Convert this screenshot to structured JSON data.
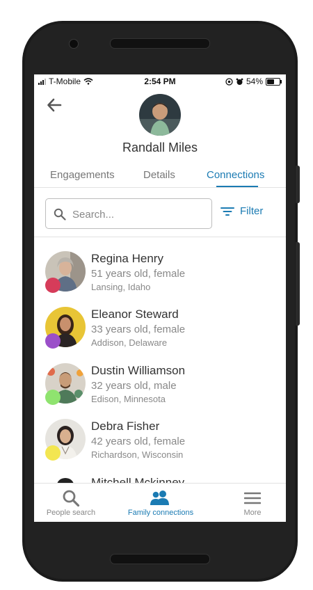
{
  "status_bar": {
    "carrier": "T-Mobile",
    "time": "2:54 PM",
    "battery": "54%"
  },
  "header": {
    "name": "Randall Miles"
  },
  "tabs": [
    {
      "label": "Engagements"
    },
    {
      "label": "Details"
    },
    {
      "label": "Connections"
    }
  ],
  "search": {
    "placeholder": "Search..."
  },
  "filter": {
    "label": "Filter"
  },
  "connections": [
    {
      "name": "Regina Henry",
      "details": "51 years old, female",
      "location": "Lansing, Idaho",
      "dot_color": "#d63c5a"
    },
    {
      "name": "Eleanor Steward",
      "details": "33 years old, female",
      "location": "Addison, Delaware",
      "dot_color": "#9b4fc9"
    },
    {
      "name": "Dustin Williamson",
      "details": "32 years old, male",
      "location": "Edison, Minnesota",
      "dot_color": "#8fe36f"
    },
    {
      "name": "Debra Fisher",
      "details": "42 years old, female",
      "location": "Richardson, Wisconsin",
      "dot_color": "#f3e651"
    },
    {
      "name": "Mitchell Mckinney",
      "details": "",
      "location": "",
      "dot_color": ""
    }
  ],
  "bottom_nav": [
    {
      "label": "People search",
      "icon": "search-icon"
    },
    {
      "label": "Family connections",
      "icon": "people-icon"
    },
    {
      "label": "More",
      "icon": "menu-icon"
    }
  ],
  "colors": {
    "accent": "#1b7bb3"
  }
}
